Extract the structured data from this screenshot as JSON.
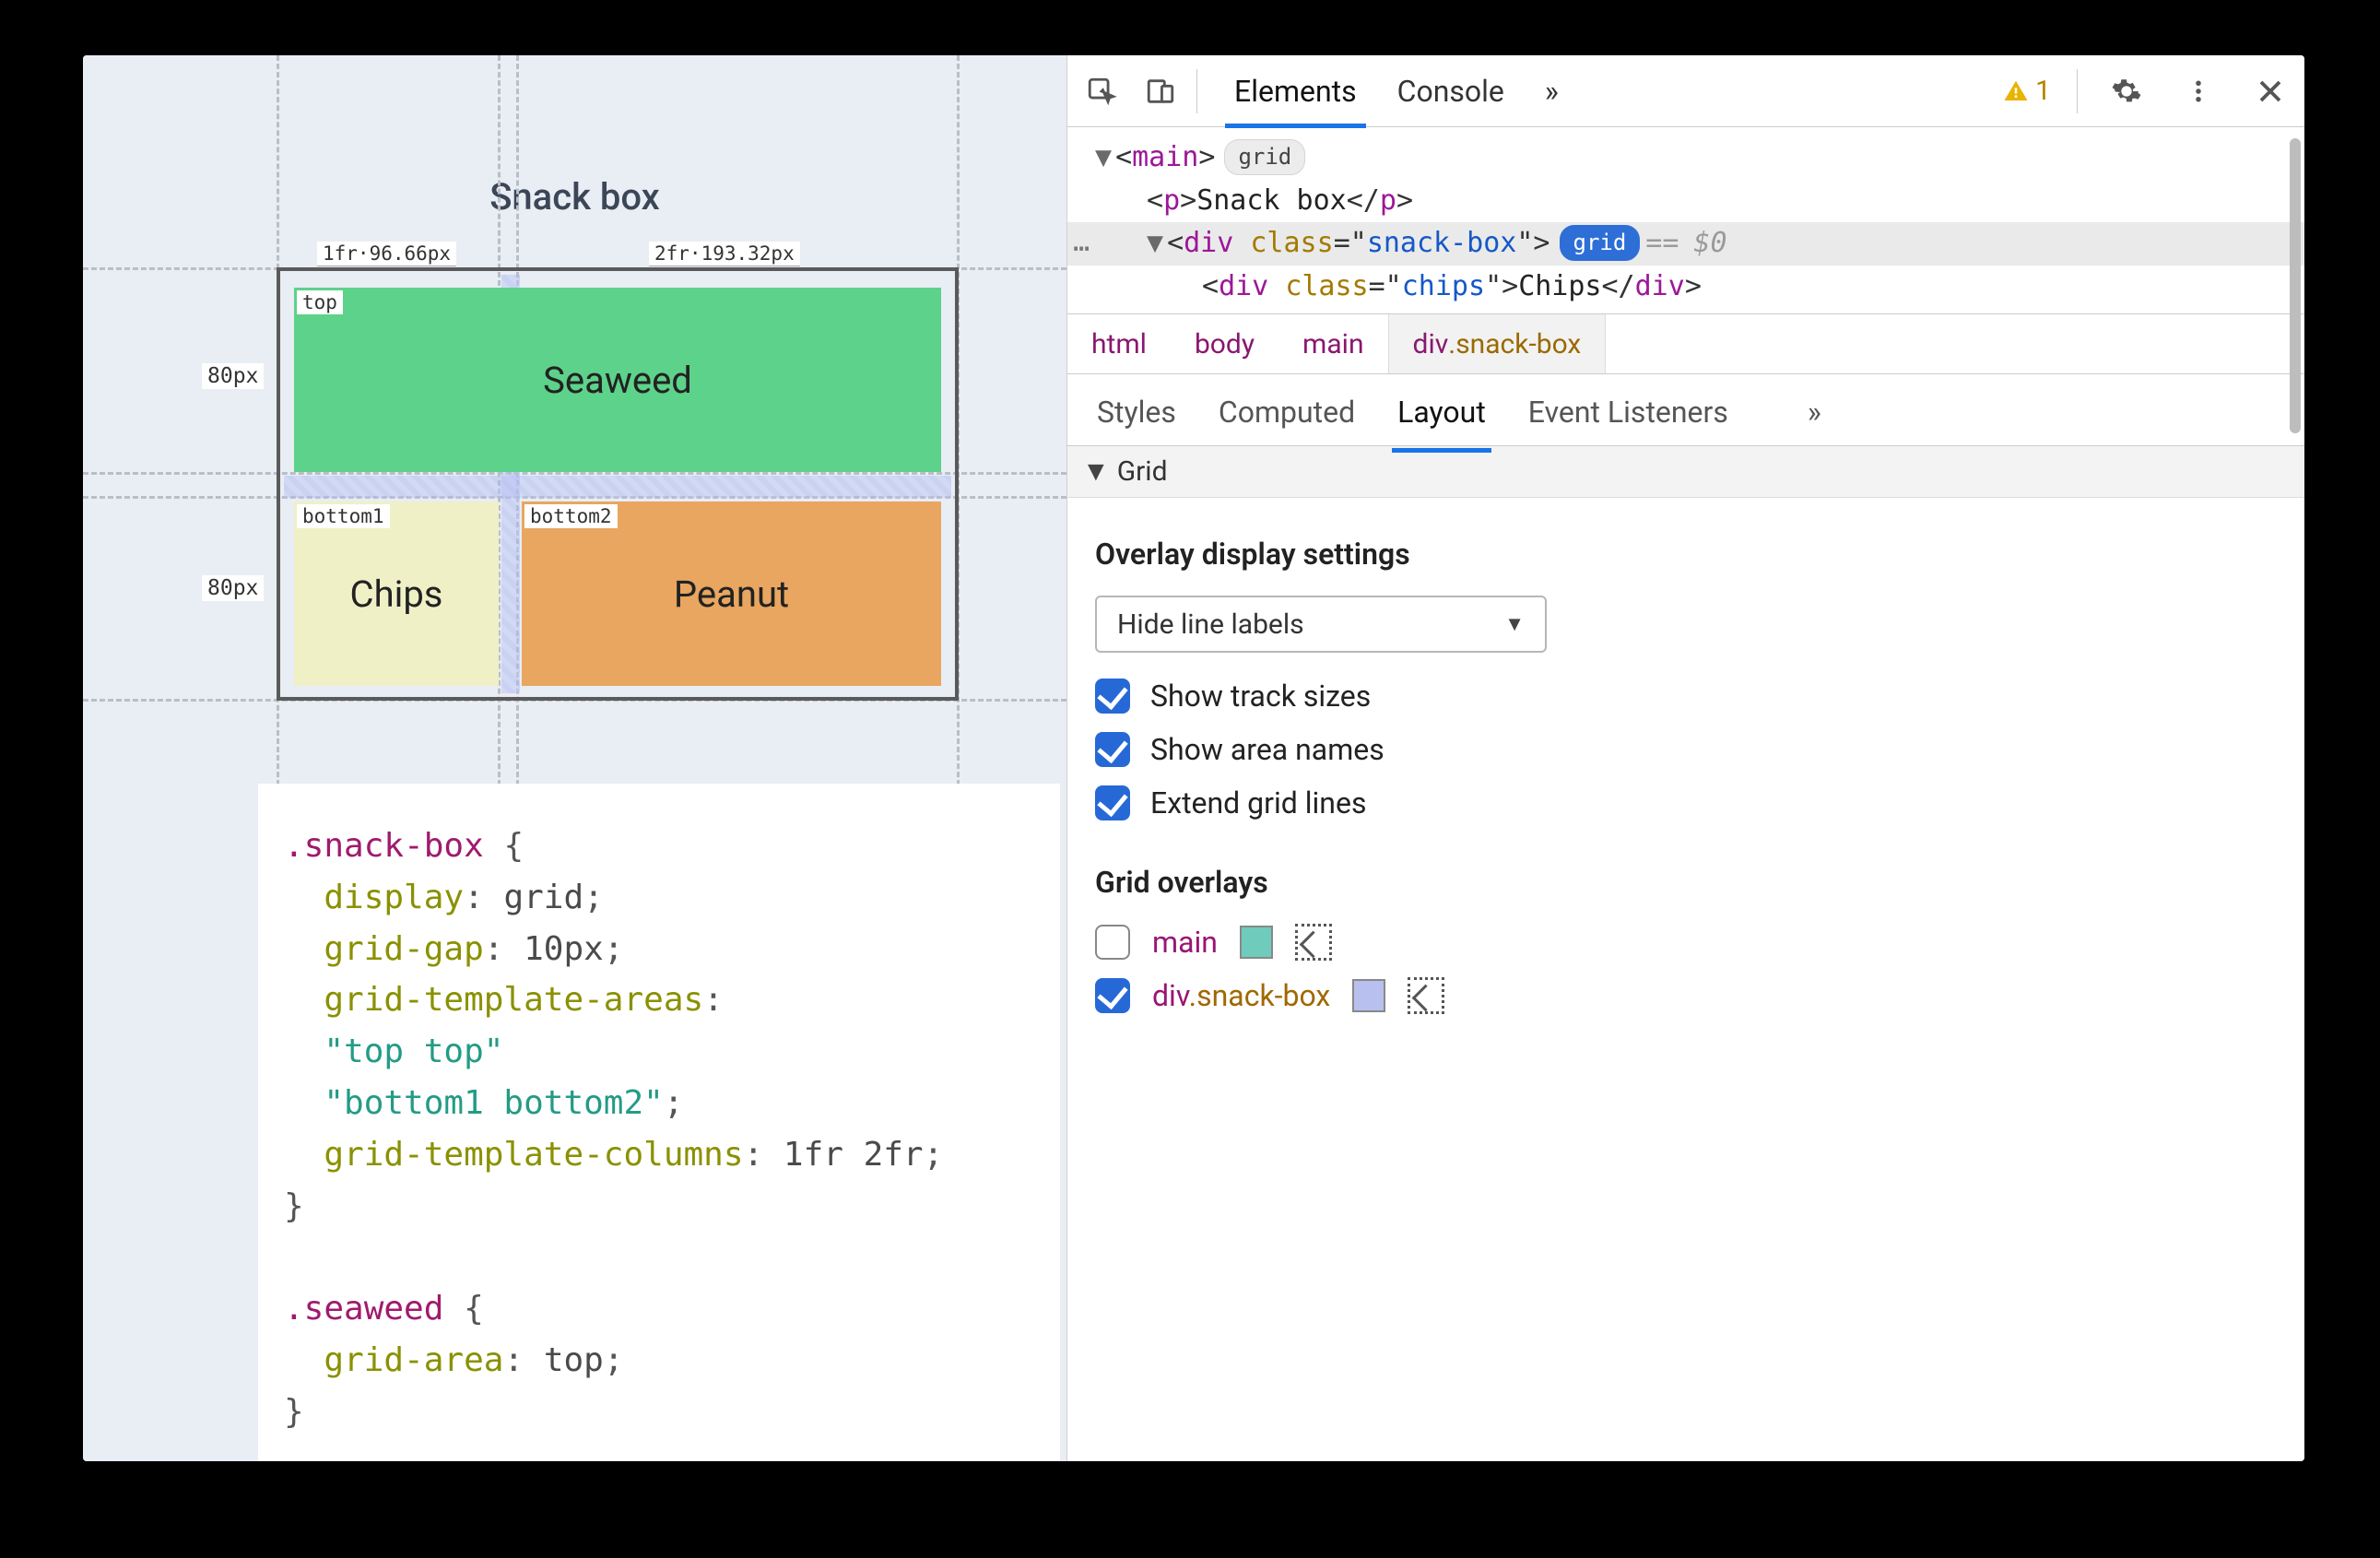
{
  "page": {
    "title": "Snack box",
    "grid": {
      "col_track_1": "1fr·96.66px",
      "col_track_2": "2fr·193.32px",
      "row_size_1": "80px",
      "row_size_2": "80px",
      "area_top": "top",
      "area_bottom1": "bottom1",
      "area_bottom2": "bottom2",
      "seaweed_label": "Seaweed",
      "chips_label": "Chips",
      "peanut_label": "Peanut"
    },
    "css": {
      "sel1": ".snack-box",
      "l1_prop": "display",
      "l1_val": "grid",
      "l2_prop": "grid-gap",
      "l2_val": "10px",
      "l3_prop": "grid-template-areas",
      "l3_val1": "\"top top\"",
      "l3_val2": "\"bottom1 bottom2\"",
      "l4_prop": "grid-template-columns",
      "l4_val": "1fr 2fr",
      "sel2": ".seaweed",
      "l5_prop": "grid-area",
      "l5_val": "top"
    }
  },
  "devtools": {
    "tabs": {
      "elements": "Elements",
      "console": "Console"
    },
    "warn_count": "1",
    "dom": {
      "main_open": "main",
      "main_badge": "grid",
      "p_text": "Snack box",
      "div_class": "snack-box",
      "div_badge": "grid",
      "eq": "==",
      "ref": "$0",
      "child_class": "chips",
      "child_text": "Chips"
    },
    "breadcrumb": {
      "b1": "html",
      "b2": "body",
      "b3": "main",
      "b4_el": "div",
      "b4_cls": ".snack-box"
    },
    "subtabs": {
      "styles": "Styles",
      "computed": "Computed",
      "layout": "Layout",
      "events": "Event Listeners"
    },
    "layout": {
      "section_title": "Grid",
      "overlay_heading": "Overlay display settings",
      "select_value": "Hide line labels",
      "opt_track_sizes": "Show track sizes",
      "opt_area_names": "Show area names",
      "opt_extend": "Extend grid lines",
      "overlays_heading": "Grid overlays",
      "ov1_name": "main",
      "ov2_el": "div",
      "ov2_cls": ".snack-box",
      "ov1_swatch": "#6fcbbc",
      "ov2_swatch": "#b8c0ef"
    }
  }
}
